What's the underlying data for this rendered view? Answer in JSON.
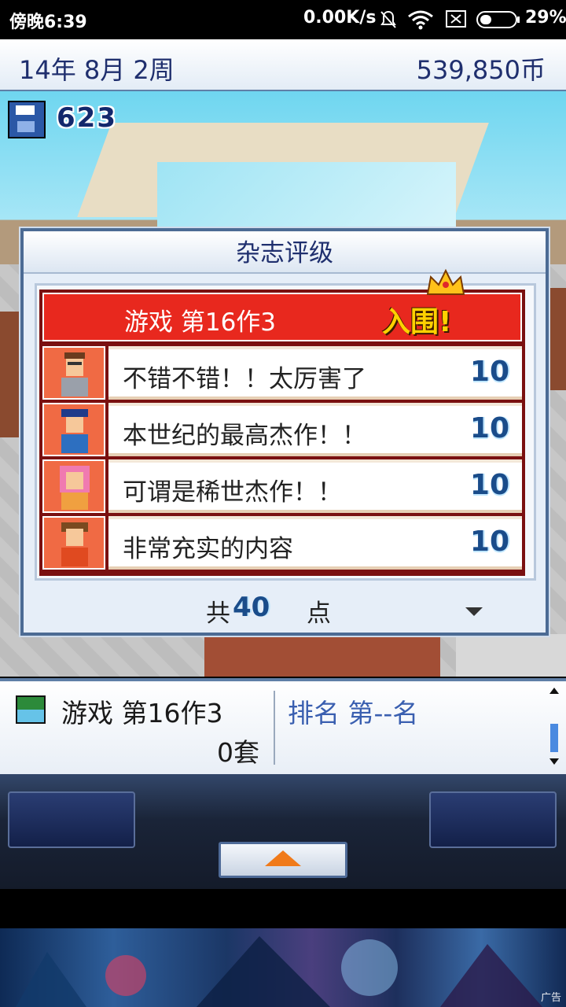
{
  "status_bar": {
    "time": "傍晚6:39",
    "network_speed": "0.00K/s",
    "battery": "29%",
    "icons": [
      "bell-muted-icon",
      "wifi-icon",
      "sim-icon",
      "battery-icon"
    ]
  },
  "header": {
    "date": "14年 8月 2周",
    "money": "539,850币"
  },
  "save": {
    "icon": "floppy-disk-icon",
    "count": "623"
  },
  "review_dialog": {
    "title": "杂志评级",
    "game_name": "游戏 第16作3",
    "award": "入围!",
    "reviews": [
      {
        "comment": "不错不错！！太厉害了",
        "score": "10",
        "avatar": "reviewer-glasses-icon"
      },
      {
        "comment": "本世纪的最高杰作！！",
        "score": "10",
        "avatar": "reviewer-hat-icon"
      },
      {
        "comment": "可谓是稀世杰作！！",
        "score": "10",
        "avatar": "reviewer-pink-hair-icon"
      },
      {
        "comment": "非常充实的内容",
        "score": "10",
        "avatar": "reviewer-brown-hair-icon"
      }
    ],
    "total_prefix": "共",
    "total_value": "40",
    "total_suffix": "点"
  },
  "info_bar": {
    "game_name": "游戏 第16作3",
    "units_sold": "0套",
    "rank": "排名 第--名"
  },
  "ad": {
    "label": "广告"
  },
  "colors": {
    "header_text": "#1f2f6e",
    "banner_red": "#e8281e",
    "award_yellow": "#ffd100",
    "score_blue": "#1a4c8a",
    "rank_blue": "#3a5fb0"
  }
}
